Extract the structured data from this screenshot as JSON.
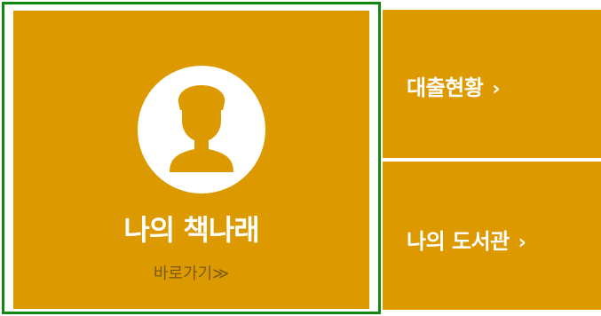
{
  "main": {
    "title": "나의 책나래",
    "link_label": "바로가기≫",
    "icon": "user-silhouette-icon"
  },
  "side": [
    {
      "label": "대출현황",
      "arrow": "›"
    },
    {
      "label": "나의 도서관",
      "arrow": "›"
    }
  ],
  "colors": {
    "tile": "#dc9a00",
    "focus_border": "#128a12",
    "text": "#ffffff",
    "link_text": "#7a5a10"
  }
}
